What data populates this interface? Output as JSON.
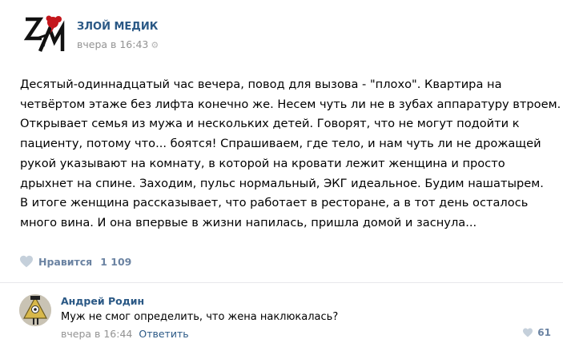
{
  "post": {
    "group_name": "ЗЛОЙ МЕДИК",
    "time": "вчера в 16:43",
    "time_icon": "gear-icon",
    "text_lines": [
      "Десятый-одиннадцатый час вечера, повод для вызова - \"плохо\". Квартира на",
      "четвёртом этаже без лифта конечно же. Несем чуть ли не в зубах аппаратуру втроем.",
      "Открывает семья из мужа и нескольких детей. Говорят, что не могут подойти к",
      "пациенту, потому что... боятся! Спрашиваем, где тело, и нам чуть ли не дрожащей",
      "рукой указывают на комнату, в которой на кровати лежит женщина и просто",
      "дрыхнет на спине. Заходим, пульс нормальный, ЭКГ идеальное. Будим нашатырем.",
      "В итоге женщина рассказывает, что работает в ресторане, а в тот день осталось",
      "много вина. И она впервые в жизни напилась, пришла домой и заснула..."
    ],
    "likes_label": "Нравится",
    "likes_count": "1 109"
  },
  "comment": {
    "author": "Андрей Родин",
    "text": "Муж не смог определить, что жена наклюкалась?",
    "time": "вчера в 16:44",
    "reply_label": "Ответить",
    "likes_count": "61"
  },
  "colors": {
    "link": "#2a5885",
    "muted": "#939393",
    "like": "#6b83a2",
    "logo_red": "#c4161c"
  }
}
